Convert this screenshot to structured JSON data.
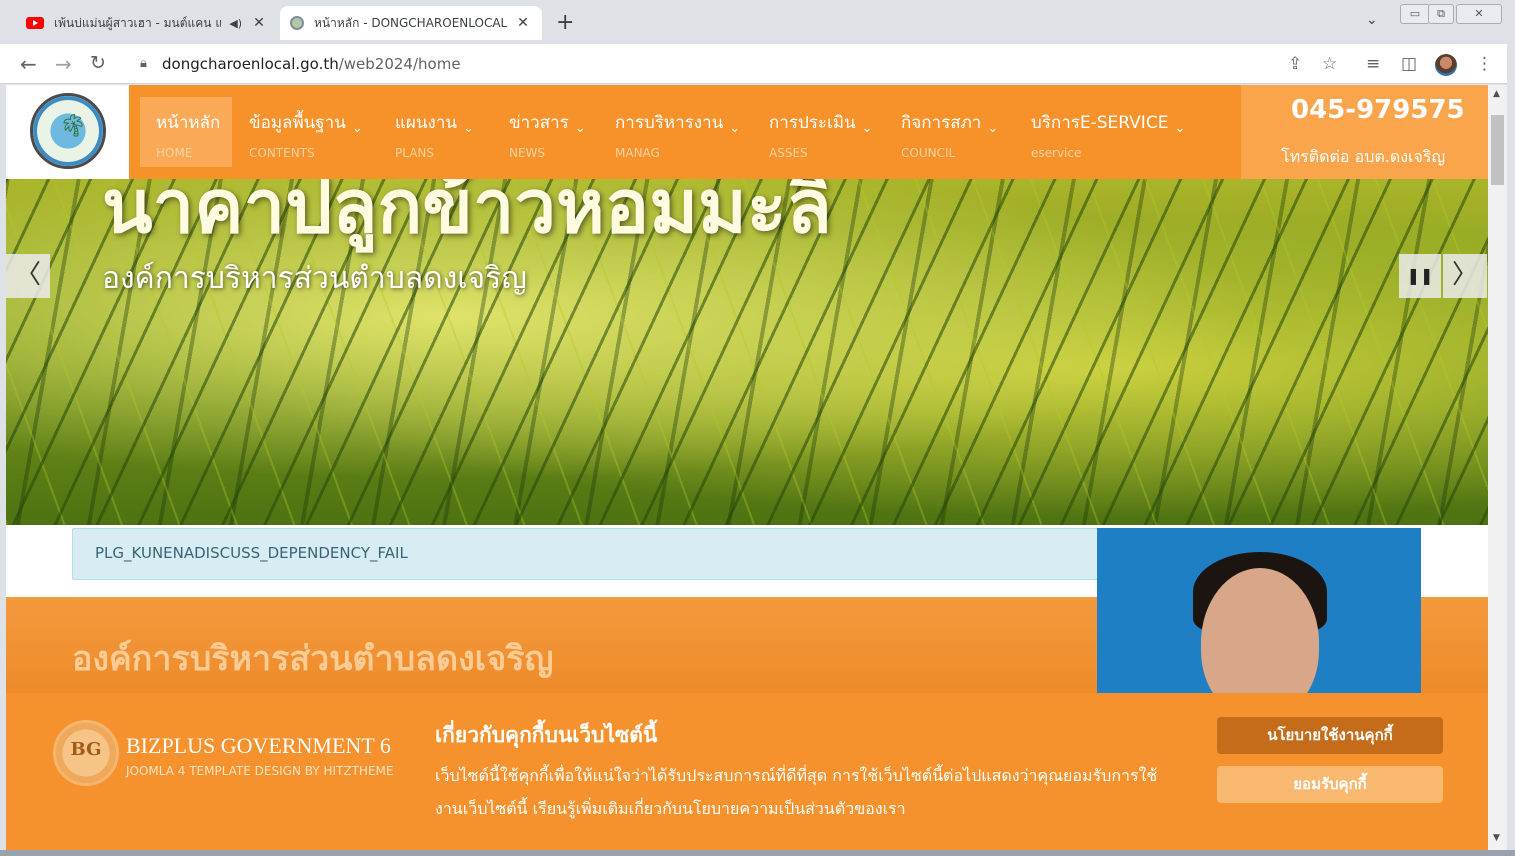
{
  "browser": {
    "tabs": [
      {
        "title": "เพ้นบ่แม่นผู้สาวเฮา - มนต์แคน แก",
        "active": false
      },
      {
        "title": "หน้าหลัก - DONGCHAROENLOCAL",
        "active": true
      }
    ],
    "url_host": "dongcharoenlocal.go.th",
    "url_path": "/web2024/home"
  },
  "header": {
    "nav": [
      {
        "th": "หน้าหลัก",
        "en": "HOME",
        "dropdown": false
      },
      {
        "th": "ข้อมูลพื้นฐาน",
        "en": "CONTENTS",
        "dropdown": true
      },
      {
        "th": "แผนงาน",
        "en": "PLANS",
        "dropdown": true
      },
      {
        "th": "ข่าวสาร",
        "en": "NEWS",
        "dropdown": true
      },
      {
        "th": "การบริหารงาน",
        "en": "MANAG",
        "dropdown": true
      },
      {
        "th": "การประเมิน",
        "en": "ASSES",
        "dropdown": true
      },
      {
        "th": "กิจการสภา",
        "en": "COUNCIL",
        "dropdown": true
      },
      {
        "th": "บริการE-SERVICE",
        "en": "eservice",
        "dropdown": true
      }
    ],
    "phone": "045-979575",
    "phone_label": "โทรติดต่อ อบต.ดงเจริญ"
  },
  "hero": {
    "title": "นาคาปลูกข้าวหอมมะลิ",
    "subtitle": "องค์การบริหารส่วนตำบลดงเจริญ"
  },
  "notice": {
    "text": "PLG_KUNENADISCUSS_DEPENDENCY_FAIL"
  },
  "section": {
    "title": "องค์การบริหารส่วนตำบลดงเจริญ"
  },
  "cookie": {
    "brand_mark": "BG",
    "brand_title": "BIZPLUS GOVERNMENT 6",
    "brand_sub": "JOOMLA 4 TEMPLATE DESIGN BY HITZTHEME",
    "title": "เกี่ยวกับคุกกี้บนเว็บไซต์นี้",
    "text": "เว็บไซต์นี้ใช้คุกกี้เพื่อให้แน่ใจว่าได้รับประสบการณ์ที่ดีที่สุด การใช้เว็บไซต์นี้ต่อไปแสดงว่าคุณยอมรับการใช้งานเว็บไซต์นี้ เรียนรู้เพิ่มเติมเกี่ยวกับนโยบายความเป็นส่วนตัวของเรา",
    "policy_button": "นโยบายใช้งานคุกกี้",
    "accept_button": "ยอมรับคุกกี้"
  },
  "colors": {
    "brand_orange": "#f7922a",
    "phone_box": "#faa54c",
    "notice_bg": "#d8ecf3"
  }
}
